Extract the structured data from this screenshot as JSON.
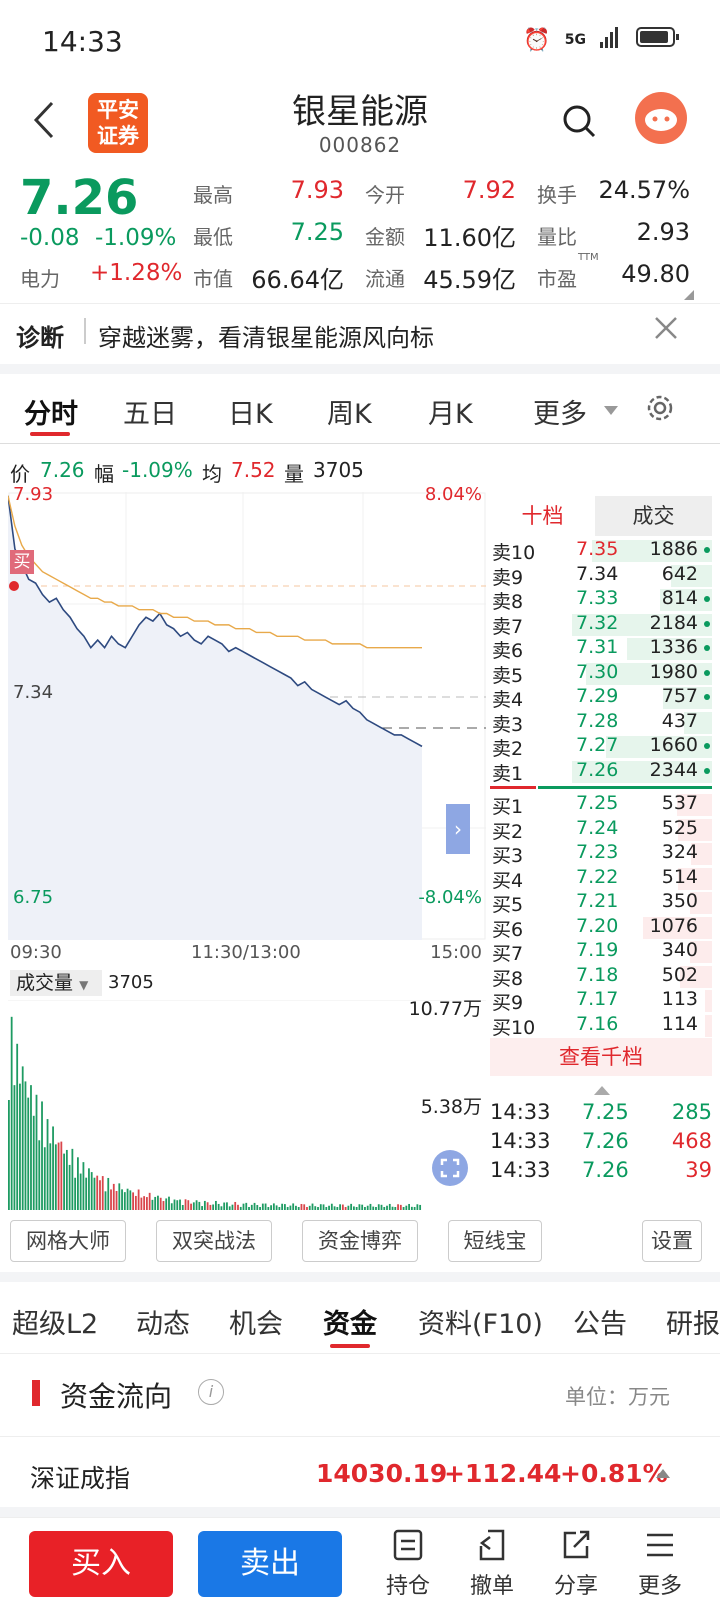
{
  "status": {
    "time": "14:33",
    "network": "5G"
  },
  "header": {
    "title": "银星能源",
    "code": "000862",
    "broker_logo": "平安\n证券"
  },
  "quote": {
    "price": "7.26",
    "change": "-0.08",
    "change_pct": "-1.09%",
    "sector_label": "电力",
    "sector_pct": "+1.28%",
    "fields": [
      {
        "label": "最高",
        "value": "7.93",
        "color": "#e0282d"
      },
      {
        "label": "今开",
        "value": "7.92",
        "color": "#e0282d"
      },
      {
        "label": "换手",
        "value": "24.57%",
        "color": "#222"
      },
      {
        "label": "最低",
        "value": "7.25",
        "color": "#0a9a5e"
      },
      {
        "label": "金额",
        "value": "11.60亿",
        "color": "#222"
      },
      {
        "label": "量比",
        "value": "2.93",
        "color": "#222"
      },
      {
        "label": "市值",
        "value": "66.64亿",
        "color": "#222"
      },
      {
        "label": "流通",
        "value": "45.59亿",
        "color": "#222"
      },
      {
        "label": "市盈",
        "value": "49.80",
        "color": "#222"
      }
    ],
    "ttm": "TTM"
  },
  "diagnosis": {
    "label": "诊断",
    "text": "穿越迷雾，看清银星能源风向标"
  },
  "chart_tabs": [
    "分时",
    "五日",
    "日K",
    "周K",
    "月K",
    "更多"
  ],
  "price_info": {
    "p_label": "价",
    "p_value": "7.26",
    "f_label": "幅",
    "f_value": "-1.09%",
    "avg_label": "均",
    "avg_value": "7.52",
    "vol_label": "量",
    "vol_value": "3705"
  },
  "chart_labels": {
    "top_price": "7.93",
    "top_pct": "8.04%",
    "bottom_price": "6.75",
    "bottom_pct": "-8.04%",
    "ref": "7.34",
    "buy_marker": "买",
    "t_start": "09:30",
    "t_mid": "11:30/13:00",
    "t_end": "15:00"
  },
  "volume": {
    "label": "成交量",
    "value": "3705",
    "max": "10.77万",
    "mid": "5.38万"
  },
  "chart_data": {
    "type": "line",
    "ylim": [
      6.75,
      7.93
    ],
    "prev_close": 7.34,
    "series": [
      {
        "name": "价",
        "values": [
          7.92,
          7.78,
          7.74,
          7.7,
          7.69,
          7.66,
          7.64,
          7.65,
          7.62,
          7.6,
          7.57,
          7.55,
          7.52,
          7.54,
          7.52,
          7.55,
          7.53,
          7.52,
          7.55,
          7.58,
          7.6,
          7.59,
          7.61,
          7.58,
          7.57,
          7.55,
          7.56,
          7.54,
          7.53,
          7.55,
          7.54,
          7.53,
          7.51,
          7.52,
          7.51,
          7.5,
          7.49,
          7.48,
          7.47,
          7.46,
          7.45,
          7.44,
          7.42,
          7.43,
          7.41,
          7.4,
          7.39,
          7.38,
          7.37,
          7.38,
          7.36,
          7.35,
          7.33,
          7.32,
          7.31,
          7.3,
          7.29,
          7.29,
          7.28,
          7.27,
          7.26
        ]
      },
      {
        "name": "均",
        "values": [
          7.92,
          7.84,
          7.79,
          7.76,
          7.74,
          7.72,
          7.71,
          7.7,
          7.69,
          7.68,
          7.67,
          7.66,
          7.65,
          7.65,
          7.64,
          7.64,
          7.63,
          7.63,
          7.63,
          7.62,
          7.62,
          7.62,
          7.61,
          7.61,
          7.6,
          7.6,
          7.6,
          7.59,
          7.59,
          7.59,
          7.58,
          7.58,
          7.58,
          7.57,
          7.57,
          7.57,
          7.56,
          7.56,
          7.56,
          7.55,
          7.55,
          7.55,
          7.55,
          7.54,
          7.54,
          7.54,
          7.54,
          7.53,
          7.53,
          7.53,
          7.53,
          7.53,
          7.52,
          7.52,
          7.52,
          7.52,
          7.52,
          7.52,
          7.52,
          7.52,
          7.52
        ]
      }
    ]
  },
  "book": {
    "tabs": [
      "十档",
      "成交"
    ],
    "asks": [
      {
        "label": "卖10",
        "price": "7.35",
        "vol": "1886",
        "w": 0.86
      },
      {
        "label": "卖9",
        "price": "7.34",
        "vol": "642",
        "w": 0.29
      },
      {
        "label": "卖8",
        "price": "7.33",
        "vol": "814",
        "w": 0.37
      },
      {
        "label": "卖7",
        "price": "7.32",
        "vol": "2184",
        "w": 1.0
      },
      {
        "label": "卖6",
        "price": "7.31",
        "vol": "1336",
        "w": 0.61
      },
      {
        "label": "卖5",
        "price": "7.30",
        "vol": "1980",
        "w": 0.9
      },
      {
        "label": "卖4",
        "price": "7.29",
        "vol": "757",
        "w": 0.35
      },
      {
        "label": "卖3",
        "price": "7.28",
        "vol": "437",
        "w": 0.2
      },
      {
        "label": "卖2",
        "price": "7.27",
        "vol": "1660",
        "w": 0.76
      },
      {
        "label": "卖1",
        "price": "7.26",
        "vol": "2344",
        "w": 1.0
      }
    ],
    "bids": [
      {
        "label": "买1",
        "price": "7.25",
        "vol": "537",
        "w": 0.25
      },
      {
        "label": "买2",
        "price": "7.24",
        "vol": "525",
        "w": 0.24
      },
      {
        "label": "买3",
        "price": "7.23",
        "vol": "324",
        "w": 0.15
      },
      {
        "label": "买4",
        "price": "7.22",
        "vol": "514",
        "w": 0.24
      },
      {
        "label": "买5",
        "price": "7.21",
        "vol": "350",
        "w": 0.16
      },
      {
        "label": "买6",
        "price": "7.20",
        "vol": "1076",
        "w": 0.49
      },
      {
        "label": "买7",
        "price": "7.19",
        "vol": "340",
        "w": 0.16
      },
      {
        "label": "买8",
        "price": "7.18",
        "vol": "502",
        "w": 0.23
      },
      {
        "label": "买9",
        "price": "7.17",
        "vol": "113",
        "w": 0.05
      },
      {
        "label": "买10",
        "price": "7.16",
        "vol": "114",
        "w": 0.05
      }
    ],
    "view_more": "查看千档",
    "trades": [
      {
        "time": "14:33",
        "price": "7.25",
        "vol": "285",
        "color": "#0a9a5e"
      },
      {
        "time": "14:33",
        "price": "7.26",
        "vol": "468",
        "color": "#e0282d"
      },
      {
        "time": "14:33",
        "price": "7.26",
        "vol": "39",
        "color": "#e0282d"
      }
    ]
  },
  "tools": [
    "网格大师",
    "双突战法",
    "资金博弈",
    "短线宝",
    "设置"
  ],
  "info_tabs": [
    "超级L2",
    "动态",
    "机会",
    "资金",
    "资料(F10)",
    "公告",
    "研报"
  ],
  "flow": {
    "title": "资金流向",
    "unit": "单位：万元"
  },
  "index": {
    "name": "深证成指",
    "value": "14030.19",
    "change": "+112.44",
    "pct": "+0.81%"
  },
  "bottom": {
    "buy": "买入",
    "sell": "卖出",
    "nav": [
      "持仓",
      "撤单",
      "分享",
      "更多"
    ]
  }
}
